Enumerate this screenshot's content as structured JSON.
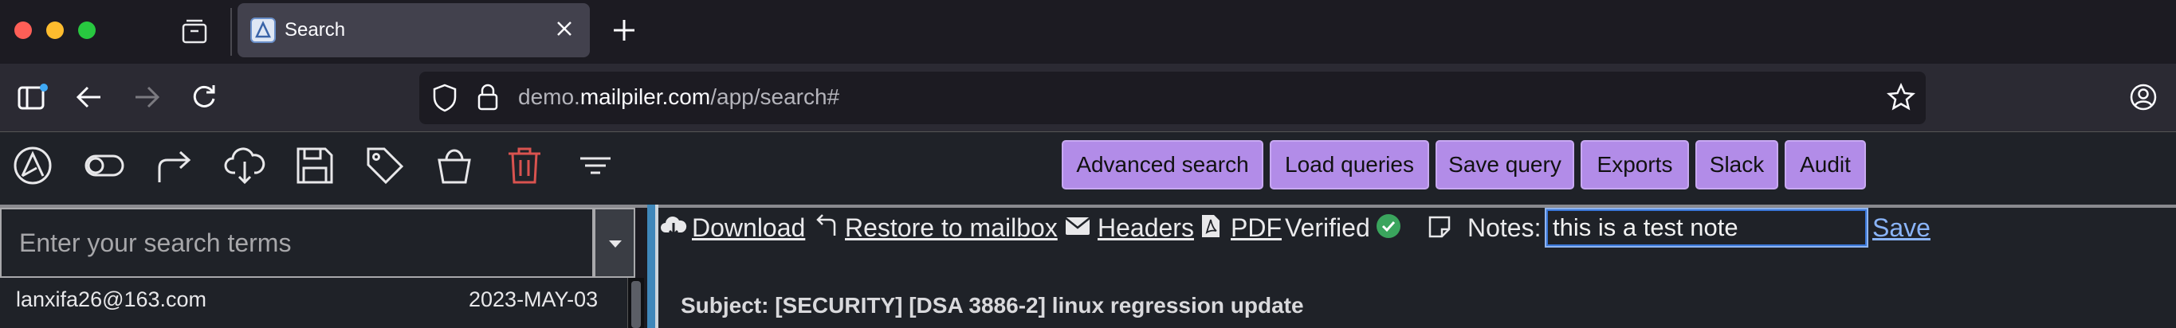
{
  "browser": {
    "tab_title": "Search",
    "url_host_prefix": "demo.",
    "url_host_main": "mailpiler.com",
    "url_path": "/app/search#",
    "traffic_lights": {
      "close": "#fe5f57",
      "minimize": "#febc2e",
      "maximize": "#28c840"
    }
  },
  "toolbar": {
    "icons": [
      "piler-logo-icon",
      "toggle-icon",
      "forward-arrow-icon",
      "cloud-download-icon",
      "floppy-save-icon",
      "tag-icon",
      "bucket-icon",
      "trash-icon",
      "filter-icon"
    ],
    "buttons": {
      "advanced_search": "Advanced search",
      "load_queries": "Load queries",
      "save_query": "Save query",
      "exports": "Exports",
      "slack": "Slack",
      "audit": "Audit"
    },
    "button_color": "#b28ce8"
  },
  "search": {
    "placeholder": "Enter your search terms"
  },
  "results": [
    {
      "from": "lanxifa26@163.com",
      "date": "2023-MAY-03"
    }
  ],
  "message": {
    "download": "Download",
    "restore": "Restore to mailbox",
    "headers": "Headers",
    "pdf": "PDF",
    "verified": "Verified",
    "notes_label": "Notes:",
    "notes_value": "this is a test note",
    "save": "Save",
    "subject": "Subject: [SECURITY] [DSA 3886-2] linux regression update"
  }
}
